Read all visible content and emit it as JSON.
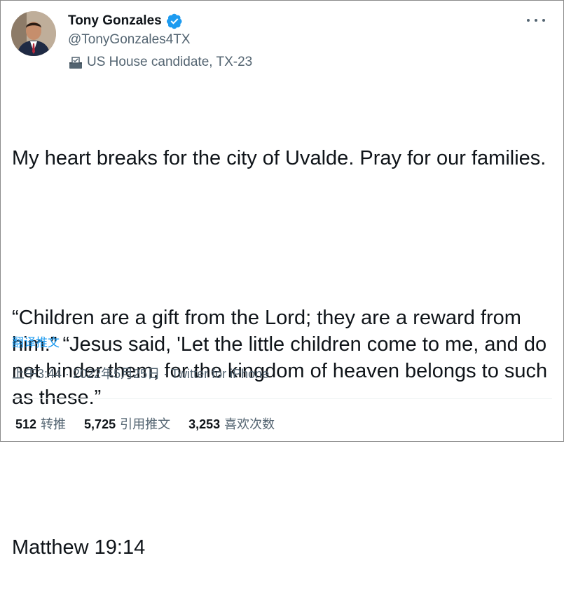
{
  "user": {
    "name": "Tony Gonzales",
    "handle": "@TonyGonzales4TX",
    "label": "US House candidate, TX-23"
  },
  "tweet": {
    "paragraph1": "My heart breaks for the city of Uvalde. Pray for our families.",
    "paragraph2": "“Children are a gift from the Lord; they are a reward from him.” “Jesus said, 'Let the little children come to me, and do not hinder them, for the kingdom of heaven belongs to such as these.”",
    "paragraph3": "Matthew 19:14",
    "translate": "翻译推文"
  },
  "meta": {
    "timestamp": "上午3:44 · 2022年5月25日 · Twitter for iPhone"
  },
  "stats": {
    "retweets_count": "512",
    "retweets_label": "转推",
    "quotes_count": "5,725",
    "quotes_label": "引用推文",
    "likes_count": "3,253",
    "likes_label": "喜欢次数"
  },
  "icons": {
    "verified": "verified-badge-icon",
    "label": "ballot-box-icon",
    "more": "more-options-icon"
  },
  "colors": {
    "accent": "#1d9bf0",
    "secondary_text": "#536471",
    "primary_text": "#0f1419"
  }
}
